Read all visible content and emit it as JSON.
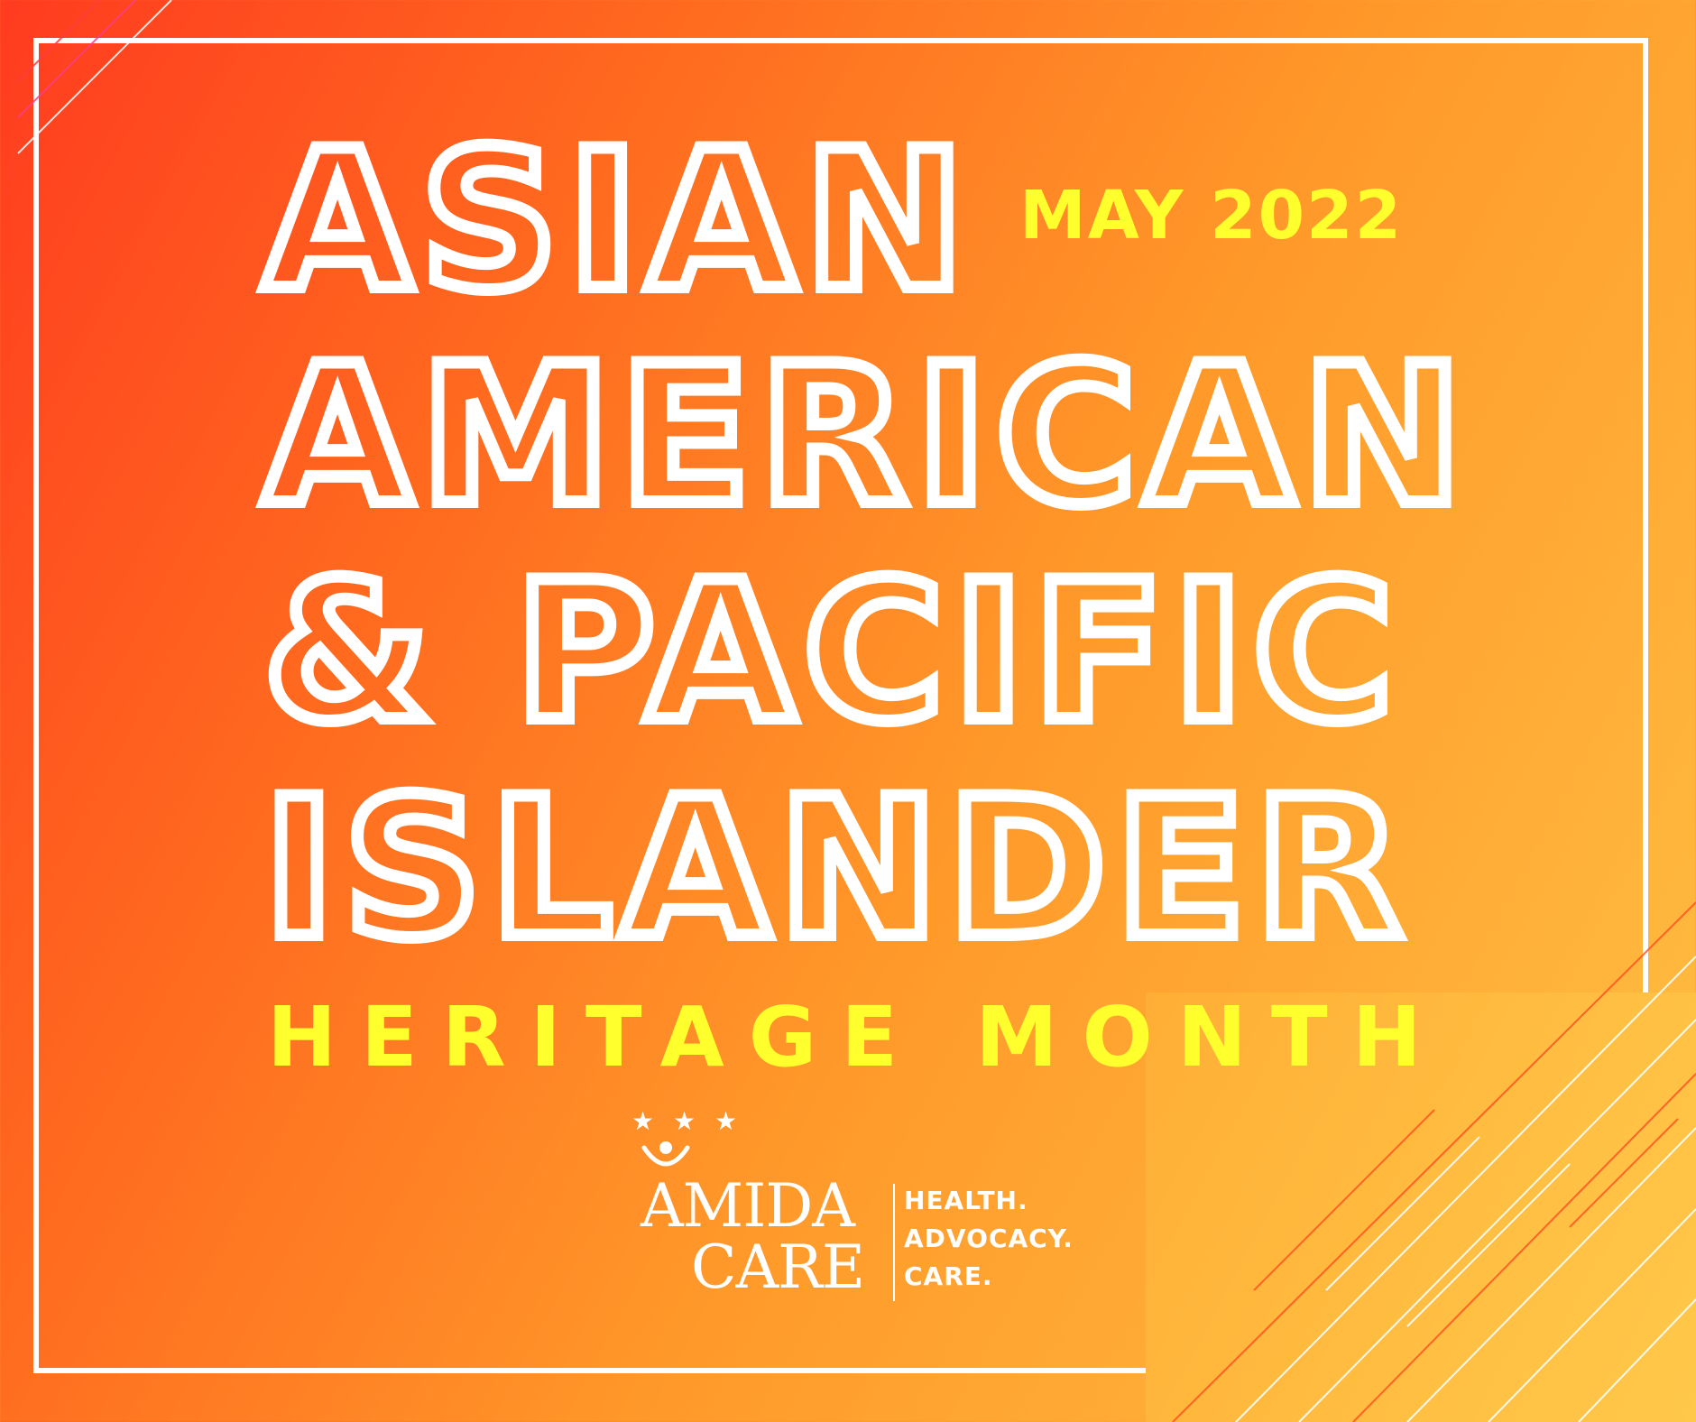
{
  "title": {
    "line1": "ASIAN",
    "line2": "AMERICAN",
    "line3": "& PACIFIC",
    "line4": "ISLANDER"
  },
  "date_label": "MAY 2022",
  "subtitle": "HERITAGE MONTH",
  "logo": {
    "word1": "AMIDA",
    "word2": "CARE",
    "tagline": [
      "HEALTH.",
      "ADVOCACY.",
      "CARE."
    ]
  },
  "colors": {
    "accent_yellow": "#ffff2e",
    "white": "#ffffff",
    "gradient_start": "#ff3b1f",
    "gradient_end": "#ffc144"
  }
}
